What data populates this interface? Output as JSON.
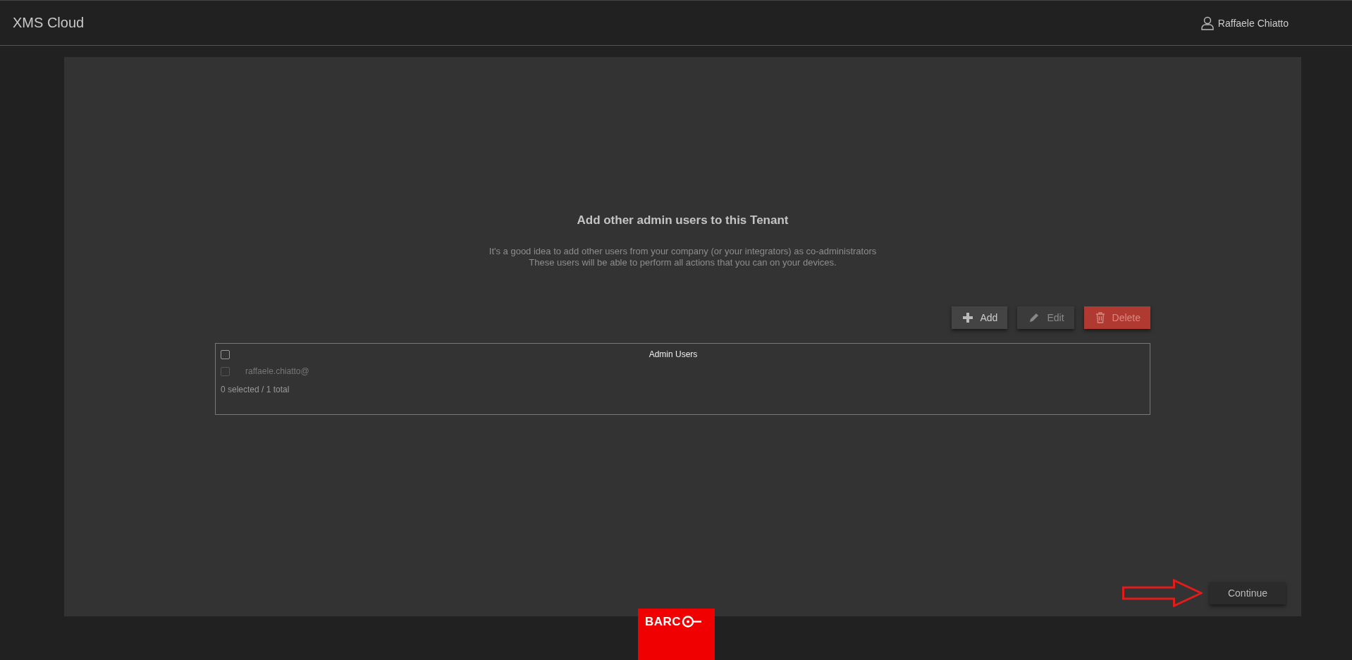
{
  "header": {
    "title": "XMS Cloud",
    "user": "Raffaele Chiatto"
  },
  "intro": {
    "title": "Add other admin users to this Tenant",
    "lines": [
      "It's a good idea to add other users from your company (or your integrators) as co-administrators",
      "These users will be able to perform all actions that you can on your devices."
    ]
  },
  "toolbar": [
    {
      "kind": "add",
      "label": "Add",
      "disabled": false
    },
    {
      "kind": "edit",
      "label": "Edit",
      "disabled": true
    },
    {
      "kind": "delete",
      "label": "Delete",
      "disabled": true
    }
  ],
  "table": {
    "header_checked": false,
    "column": "Admin Users",
    "rows": [
      {
        "email": "raffaele.chiatto@",
        "checked": false,
        "disabled": true
      }
    ],
    "footer": "0 selected / 1 total"
  },
  "continue_button": "Continue",
  "logo": "BARC"
}
